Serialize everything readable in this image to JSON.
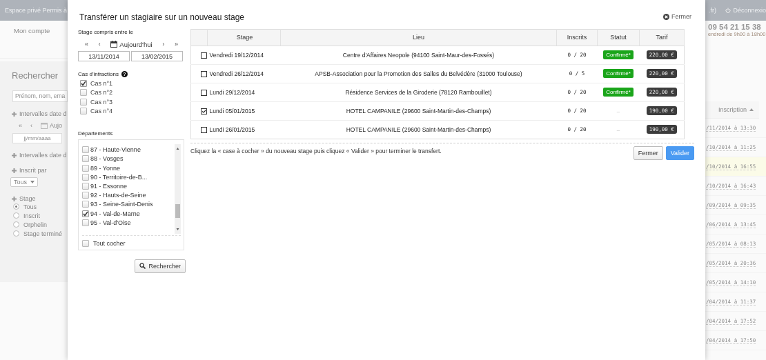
{
  "background": {
    "header": {
      "site": "Espace privé Permis à",
      "domain": ".fr)",
      "logout": "Déconnexio"
    },
    "nav": [
      "Mon compte"
    ],
    "contact": {
      "phone": "09 54 21 15 38",
      "hours": "endredi de 9h00 à 18h00"
    },
    "search": {
      "title": "Rechercher",
      "placeholder": "Prénom, nom, ema",
      "interval_1": "Intervalles date d",
      "nav": [
        "«",
        "‹"
      ],
      "today": "Aujo",
      "date_placeholder": "jj/mm/aaaa",
      "interval_2": "Intervalles date d",
      "registered_by": "Inscrit par",
      "registered_by_value": "Tous",
      "stage": "Stage",
      "stage_options": [
        {
          "label": "Tous",
          "selected": true
        },
        {
          "label": "Inscrit",
          "selected": false
        },
        {
          "label": "Orphelin",
          "selected": false
        },
        {
          "label": "Stage terminé",
          "selected": false
        }
      ]
    },
    "inscriptions": {
      "column": "Inscription",
      "rows": [
        {
          "date": "/11/2014 à 13:30",
          "highlighted": false
        },
        {
          "date": "/10/2014 à 11:25",
          "highlighted": false
        },
        {
          "date": "/10/2014 à 16:55",
          "highlighted": true
        },
        {
          "date": "/10/2014 à 16:43",
          "highlighted": false
        },
        {
          "date": "/09/2014 à 09:35",
          "highlighted": false
        },
        {
          "date": "/06/2014 à 13:45",
          "highlighted": false
        },
        {
          "date": "/05/2014 à 08:13",
          "highlighted": false
        },
        {
          "date": "/05/2014 à 20:36",
          "highlighted": false
        },
        {
          "date": "/05/2014 à 14:10",
          "highlighted": false
        },
        {
          "date": "/04/2014 à 11:37",
          "highlighted": false
        },
        {
          "date": "/04/2014 à 17:52",
          "highlighted": false
        },
        {
          "date": "/04/2014 à 17:50",
          "highlighted": false
        }
      ]
    }
  },
  "dialog": {
    "title": "Transférer un stagiaire sur un nouveau stage",
    "close": "Fermer",
    "filters": {
      "period_label": "Stage compris entre le",
      "nav": [
        "«",
        "‹",
        "›",
        "»"
      ],
      "today": "Aujourd'hui",
      "date_from": "13/11/2014",
      "date_to": "13/02/2015",
      "cases_label": "Cas d'infractions",
      "help": "?",
      "cases": [
        {
          "label": "Cas n°1",
          "checked": true
        },
        {
          "label": "Cas n°2",
          "checked": false
        },
        {
          "label": "Cas n°3",
          "checked": false
        },
        {
          "label": "Cas n°4",
          "checked": false
        }
      ],
      "departments_label": "Départements",
      "departments": [
        {
          "label": "87 - Haute-Vienne",
          "checked": false
        },
        {
          "label": "88 - Vosges",
          "checked": false
        },
        {
          "label": "89 - Yonne",
          "checked": false
        },
        {
          "label": "90 - Territoire-de-B...",
          "checked": false
        },
        {
          "label": "91 - Essonne",
          "checked": false
        },
        {
          "label": "92 - Hauts-de-Seine",
          "checked": false
        },
        {
          "label": "93 - Seine-Saint-Denis",
          "checked": false
        },
        {
          "label": "94 - Val-de-Marne",
          "checked": true
        },
        {
          "label": "95 - Val-d'Oise",
          "checked": false
        }
      ],
      "check_all": {
        "label": "Tout cocher",
        "checked": false
      },
      "search_button": "Rechercher"
    },
    "table": {
      "columns": [
        "Stage",
        "Lieu",
        "Inscrits",
        "Statut",
        "Tarif"
      ],
      "rows": [
        {
          "checked": false,
          "stage": "Vendredi 19/12/2014",
          "place": "Centre d'Affaires Neopole (94100 Saint-Maur-des-Fossés)",
          "registered": "0 / 20",
          "status": {
            "kind": "confirmed",
            "text": "Confirmé*"
          },
          "price": "220,00 €"
        },
        {
          "checked": false,
          "stage": "Vendredi 26/12/2014",
          "place": "APSB-Association pour la Promotion des Salles du Belvédère (31000 Toulouse)",
          "registered": "0 / 5",
          "status": {
            "kind": "confirmed",
            "text": "Confirmé*"
          },
          "price": "220,00 €"
        },
        {
          "checked": false,
          "stage": "Lundi 29/12/2014",
          "place": "Résidence Services de la Giroderie (78120 Rambouillet)",
          "registered": "0 / 20",
          "status": {
            "kind": "confirmed",
            "text": "Confirmé*"
          },
          "price": "220,00 €"
        },
        {
          "checked": true,
          "stage": "Lundi 05/01/2015",
          "place": "HOTEL CAMPANILE (29600 Saint-Martin-des-Champs)",
          "registered": "0 / 20",
          "status": {
            "kind": "none",
            "text": "–"
          },
          "price": "190,00 €"
        },
        {
          "checked": false,
          "stage": "Lundi 26/01/2015",
          "place": "HOTEL CAMPANILE (29600 Saint-Martin-des-Champs)",
          "registered": "0 / 20",
          "status": {
            "kind": "none",
            "text": "–"
          },
          "price": "190,00 €"
        }
      ]
    },
    "instruction": "Cliquez la « case à cocher » du nouveau stage puis cliquez « Valider » pour terminer le transfert.",
    "buttons": [
      {
        "label": "Fermer",
        "kind": "default"
      },
      {
        "label": "Valider",
        "kind": "primary"
      }
    ]
  }
}
